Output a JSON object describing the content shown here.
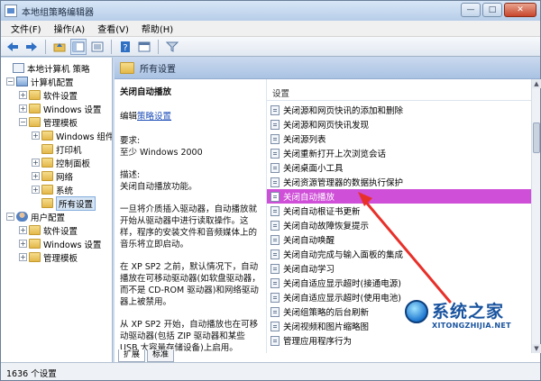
{
  "window": {
    "title": "本地组策略编辑器",
    "controls": [
      "—",
      "□",
      "✕"
    ]
  },
  "menu": [
    "文件(F)",
    "操作(A)",
    "查看(V)",
    "帮助(H)"
  ],
  "toolbar": {
    "icons": [
      "back-arrow-icon",
      "forward-arrow-icon",
      "up-folder-icon",
      "show-tree-icon",
      "export-list-icon",
      "properties-icon",
      "help-icon",
      "console-icon",
      "filter-icon"
    ]
  },
  "tree": {
    "items": [
      {
        "label": "本地计算机 策略",
        "icon": "policy",
        "level": 0,
        "expander": "none"
      },
      {
        "label": "计算机配置",
        "icon": "computer",
        "level": 1,
        "expander": "−"
      },
      {
        "label": "软件设置",
        "icon": "folder",
        "level": 2,
        "expander": "+"
      },
      {
        "label": "Windows 设置",
        "icon": "folder",
        "level": 2,
        "expander": "+"
      },
      {
        "label": "管理模板",
        "icon": "folder",
        "level": 2,
        "expander": "−"
      },
      {
        "label": "Windows 组件",
        "icon": "folder",
        "level": 3,
        "expander": "+"
      },
      {
        "label": "打印机",
        "icon": "folder",
        "level": 3,
        "expander": "none"
      },
      {
        "label": "控制面板",
        "icon": "folder",
        "level": 3,
        "expander": "+"
      },
      {
        "label": "网络",
        "icon": "folder",
        "level": 3,
        "expander": "+"
      },
      {
        "label": "系统",
        "icon": "folder",
        "level": 3,
        "expander": "+"
      },
      {
        "label": "所有设置",
        "icon": "folder",
        "level": 3,
        "expander": "none",
        "selected": true
      },
      {
        "label": "用户配置",
        "icon": "user",
        "level": 1,
        "expander": "−"
      },
      {
        "label": "软件设置",
        "icon": "folder",
        "level": 2,
        "expander": "+"
      },
      {
        "label": "Windows 设置",
        "icon": "folder",
        "level": 2,
        "expander": "+"
      },
      {
        "label": "管理模板",
        "icon": "folder",
        "level": 2,
        "expander": "+"
      }
    ]
  },
  "main": {
    "header": "所有设置",
    "description": {
      "title": "关闭自动播放",
      "edit_prefix": "编辑",
      "edit_link": "策略设置",
      "requirement_label": "要求:",
      "requirement_value": "至少 Windows 2000",
      "desc_label": "描述:",
      "paragraph1": "关闭自动播放功能。",
      "paragraph2": "一旦将介质插入驱动器，自动播放就开始从驱动器中进行读取操作。这样，程序的安装文件和音频媒体上的音乐将立即启动。",
      "paragraph3": "在 XP SP2 之前，默认情况下，自动播放在可移动驱动器(如软盘驱动器，而不是 CD-ROM 驱动器)和网络驱动器上被禁用。",
      "paragraph4": "从 XP SP2 开始，自动播放也在可移动驱动器(包括 ZIP 驱动器和某些 USB 大容量存储设备)上启用。"
    },
    "list_header": "设置",
    "rows": [
      "关闭源和网页快讯的添加和删除",
      "关闭源和网页快讯发现",
      "关闭源列表",
      "关闭重新打开上次浏览会话",
      "关闭桌面小工具",
      "关闭资源管理器的数据执行保护",
      "关闭自动播放",
      "关闭自动根证书更新",
      "关闭自动故障恢复提示",
      "关闭自动唤醒",
      "关闭自动完成与输入面板的集成",
      "关闭自动学习",
      "关闭自适应显示超时(接通电源)",
      "关闭自适应显示超时(使用电池)",
      "关闭组策略的后台刷新",
      "关闭视频和图片缩略图",
      "管理应用程序行为"
    ],
    "highlighted_row": 6,
    "tabs": [
      "扩展",
      "标准"
    ]
  },
  "status": {
    "text": "1636 个设置"
  },
  "colors": {
    "highlight": "#cf4fd8",
    "annotation_arrow": "#e8302a"
  },
  "watermark": {
    "brand": "系统之家",
    "url": "XITONGZHIJIA.NET"
  }
}
